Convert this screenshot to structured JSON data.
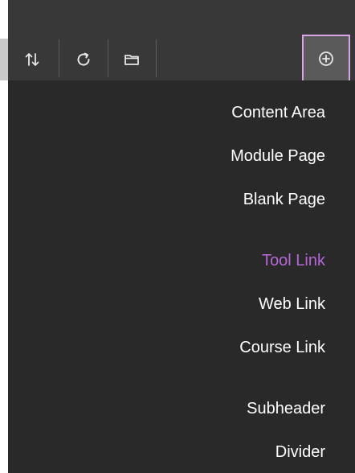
{
  "toolbar": {
    "buttons": [
      {
        "icon": "sort-arrows-icon"
      },
      {
        "icon": "refresh-icon"
      },
      {
        "icon": "folder-icon"
      }
    ],
    "add_button": {
      "icon": "add-circle-icon"
    }
  },
  "menu": {
    "items": [
      {
        "label": "Content Area"
      },
      {
        "label": "Module Page"
      },
      {
        "label": "Blank Page"
      },
      {
        "label": "Tool Link"
      },
      {
        "label": "Web Link"
      },
      {
        "label": "Course Link"
      },
      {
        "label": "Subheader"
      },
      {
        "label": "Divider"
      }
    ]
  },
  "colors": {
    "toolbar_bg": "#383838",
    "menu_bg": "#292929",
    "text": "#ffffff",
    "highlight_text": "#b766d8",
    "add_button_border": "#d7a6e6"
  }
}
